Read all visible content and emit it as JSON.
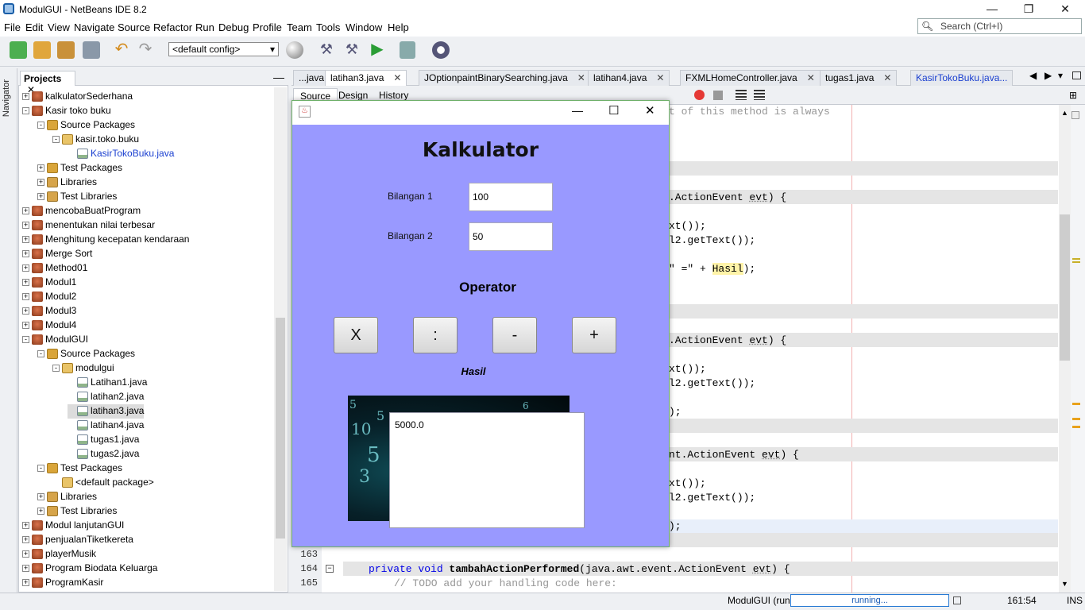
{
  "window": {
    "title": "ModulGUI - NetBeans IDE 8.2",
    "min": "—",
    "restore": "❐",
    "close": "✕"
  },
  "menu": [
    "File",
    "Edit",
    "View",
    "Navigate",
    "Source",
    "Refactor",
    "Run",
    "Debug",
    "Profile",
    "Team",
    "Tools",
    "Window",
    "Help"
  ],
  "search": {
    "placeholder": "Search (Ctrl+I)"
  },
  "toolbar": {
    "config": "<default config>"
  },
  "navigator": {
    "label": "Navigator"
  },
  "projects": {
    "tab": "Projects",
    "items": [
      {
        "label": "kalkulatorSederhana",
        "level": 0,
        "icon": "cup",
        "exp": "+"
      },
      {
        "label": "Kasir toko buku",
        "level": 0,
        "icon": "cup",
        "exp": "-"
      },
      {
        "label": "Source Packages",
        "level": 1,
        "icon": "pkg",
        "exp": "-"
      },
      {
        "label": "kasir.toko.buku",
        "level": 2,
        "icon": "pk2",
        "exp": "-"
      },
      {
        "label": "KasirTokoBuku.java",
        "level": 3,
        "icon": "jav",
        "exp": "",
        "color": "#1a3fd0"
      },
      {
        "label": "Test Packages",
        "level": 1,
        "icon": "pkg",
        "exp": "+"
      },
      {
        "label": "Libraries",
        "level": 1,
        "icon": "lib",
        "exp": "+"
      },
      {
        "label": "Test Libraries",
        "level": 1,
        "icon": "lib",
        "exp": "+"
      },
      {
        "label": "mencobaBuatProgram",
        "level": 0,
        "icon": "cup",
        "exp": "+"
      },
      {
        "label": "menentukan nilai terbesar",
        "level": 0,
        "icon": "cup",
        "exp": "+"
      },
      {
        "label": "Menghitung kecepatan kendaraan",
        "level": 0,
        "icon": "cup",
        "exp": "+"
      },
      {
        "label": "Merge Sort",
        "level": 0,
        "icon": "cup",
        "exp": "+"
      },
      {
        "label": "Method01",
        "level": 0,
        "icon": "cup",
        "exp": "+"
      },
      {
        "label": "Modul1",
        "level": 0,
        "icon": "cup",
        "exp": "+"
      },
      {
        "label": "Modul2",
        "level": 0,
        "icon": "cup",
        "exp": "+"
      },
      {
        "label": "Modul3",
        "level": 0,
        "icon": "cup",
        "exp": "+"
      },
      {
        "label": "Modul4",
        "level": 0,
        "icon": "cup",
        "exp": "+"
      },
      {
        "label": "ModulGUI",
        "level": 0,
        "icon": "cup",
        "exp": "-"
      },
      {
        "label": "Source Packages",
        "level": 1,
        "icon": "pkg",
        "exp": "-"
      },
      {
        "label": "modulgui",
        "level": 2,
        "icon": "pk2",
        "exp": "-"
      },
      {
        "label": "Latihan1.java",
        "level": 3,
        "icon": "jav",
        "exp": ""
      },
      {
        "label": "latihan2.java",
        "level": 3,
        "icon": "jav",
        "exp": ""
      },
      {
        "label": "latihan3.java",
        "level": 3,
        "icon": "jav",
        "exp": "",
        "selected": true
      },
      {
        "label": "latihan4.java",
        "level": 3,
        "icon": "jav",
        "exp": ""
      },
      {
        "label": "tugas1.java",
        "level": 3,
        "icon": "jav",
        "exp": ""
      },
      {
        "label": "tugas2.java",
        "level": 3,
        "icon": "jav",
        "exp": ""
      },
      {
        "label": "Test Packages",
        "level": 1,
        "icon": "pkg",
        "exp": "-"
      },
      {
        "label": "<default package>",
        "level": 2,
        "icon": "pk2",
        "exp": ""
      },
      {
        "label": "Libraries",
        "level": 1,
        "icon": "lib",
        "exp": "+"
      },
      {
        "label": "Test Libraries",
        "level": 1,
        "icon": "lib",
        "exp": "+"
      },
      {
        "label": "Modul lanjutanGUI",
        "level": 0,
        "icon": "cup",
        "exp": "+"
      },
      {
        "label": "penjualanTiketkereta",
        "level": 0,
        "icon": "cup",
        "exp": "+"
      },
      {
        "label": "playerMusik",
        "level": 0,
        "icon": "cup",
        "exp": "+"
      },
      {
        "label": "Program Biodata Keluarga",
        "level": 0,
        "icon": "cup",
        "exp": "+"
      },
      {
        "label": "ProgramKasir",
        "level": 0,
        "icon": "cup",
        "exp": "+"
      }
    ]
  },
  "editor": {
    "tabs": [
      {
        "label": "...java",
        "active": false
      },
      {
        "label": "latihan3.java",
        "active": true
      },
      {
        "label": "JOptionpaintBinarySearching.java",
        "active": false
      },
      {
        "label": "latihan4.java",
        "active": false
      },
      {
        "label": "FXMLHomeController.java",
        "active": false
      },
      {
        "label": "tugas1.java",
        "active": false
      },
      {
        "label": "KasirTokoBuku.java...",
        "active": false
      }
    ],
    "subtabs": [
      "Source",
      "Design",
      "History"
    ],
    "lines": {
      "l1": "t of this method is always",
      "l2a": ".ActionEvent ",
      "l2b": "evt",
      "l2c": ") {",
      "l3": "xt());",
      "l4": "l2.getText());",
      "l5a": "\" =\" + ",
      "l5b": "Hasil",
      "l5c": ");",
      "l6a": ".ActionEvent ",
      "l6b": "evt",
      "l6c": ") {",
      "l7": "xt());",
      "l8": "l2.getText());",
      "l9": ");",
      "l10a": "nt.ActionEvent ",
      "l10b": "evt",
      "l10c": ") {",
      "l11": "xt());",
      "l12": "l2.getText());",
      "l13": ");",
      "ln163": "163",
      "ln164": "164",
      "ln165": "165",
      "c164a": "private void ",
      "c164b": "tambahActionPerformed",
      "c164c": "(java.awt.event.ActionEvent ",
      "c164d": "evt",
      "c164e": ") {",
      "c165": "// TODO add your handling code here:"
    }
  },
  "status": {
    "project": "ModulGUI (run)",
    "progress": "running...",
    "position": "161:54",
    "mode": "INS"
  },
  "dialog": {
    "title": "Kalkulator",
    "label1": "Bilangan 1",
    "value1": "100",
    "label2": "Bilangan 2",
    "value2": "50",
    "operator_label": "Operator",
    "buttons": [
      "X",
      ":",
      "-",
      "+"
    ],
    "result_label": "Hasil",
    "result": "5000.0",
    "min": "—",
    "max": "☐",
    "close": "✕"
  }
}
